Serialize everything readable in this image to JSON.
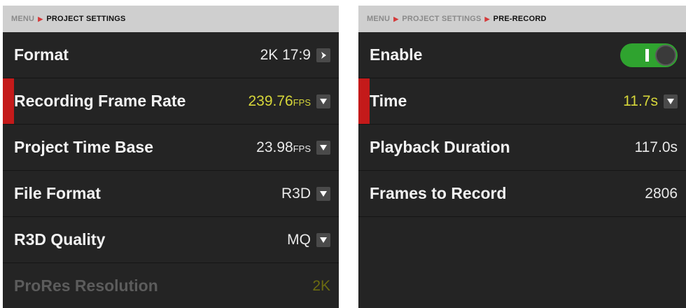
{
  "left_panel": {
    "breadcrumb": {
      "root": "MENU",
      "current": "PROJECT SETTINGS"
    },
    "rows": [
      {
        "label": "Format",
        "value": "2K 17:9",
        "unit": "",
        "control": "arrow-right"
      },
      {
        "label": "Recording Frame Rate",
        "value": "239.76",
        "unit": "FPS",
        "control": "chevron-down",
        "selected": true,
        "highlight": true
      },
      {
        "label": "Project Time Base",
        "value": "23.98",
        "unit": "FPS",
        "control": "chevron-down"
      },
      {
        "label": "File Format",
        "value": "R3D",
        "unit": "",
        "control": "chevron-down"
      },
      {
        "label": "R3D Quality",
        "value": "MQ",
        "unit": "",
        "control": "chevron-down"
      },
      {
        "label": "ProRes Resolution",
        "value": "2K",
        "unit": "",
        "control": "none",
        "disabled": true
      }
    ]
  },
  "right_panel": {
    "breadcrumb": {
      "root": "MENU",
      "middle": "PROJECT SETTINGS",
      "current": "PRE-RECORD"
    },
    "rows": [
      {
        "label": "Enable",
        "control": "toggle",
        "toggle_on": true
      },
      {
        "label": "Time",
        "value": "11.7s",
        "control": "chevron-down",
        "selected": true,
        "highlight": true
      },
      {
        "label": "Playback Duration",
        "value": "117.0s",
        "control": "none"
      },
      {
        "label": "Frames to Record",
        "value": "2806",
        "control": "none"
      }
    ]
  },
  "colors": {
    "accent_red": "#c41a1a",
    "value_yellow": "#d6d63a",
    "toggle_green": "#2fa32f",
    "panel_bg": "#242424",
    "breadcrumb_bg": "#cfcfcf"
  }
}
